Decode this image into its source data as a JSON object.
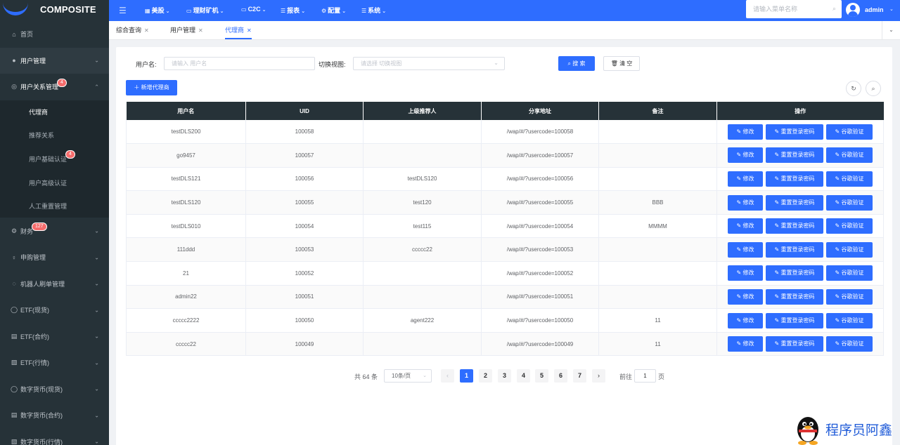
{
  "brand": {
    "title": "COMPOSITE"
  },
  "sidebar": {
    "items": [
      {
        "label": "首页",
        "icon": "home-icon"
      },
      {
        "label": "用户管理",
        "icon": "user-icon"
      },
      {
        "label": "用户关系管理",
        "icon": "user-circle-icon",
        "badge": "4"
      },
      {
        "label": "财务",
        "icon": "gear-icon",
        "badge": "127"
      },
      {
        "label": "申购管理",
        "icon": "bulb-icon"
      },
      {
        "label": "机器人刷单管理",
        "icon": "robot-icon"
      },
      {
        "label": "ETF(现货)",
        "icon": "coin-icon"
      },
      {
        "label": "ETF(合约)",
        "icon": "doc-icon"
      },
      {
        "label": "ETF(行情)",
        "icon": "edit-icon"
      },
      {
        "label": "数字货币(现货)",
        "icon": "coin-icon"
      },
      {
        "label": "数字货币(合约)",
        "icon": "doc-icon"
      },
      {
        "label": "数字货币(行情)",
        "icon": "edit-icon"
      }
    ],
    "sub_items": [
      {
        "label": "代理商"
      },
      {
        "label": "推荐关系"
      },
      {
        "label": "用户基础认证",
        "badge": "4"
      },
      {
        "label": "用户高级认证"
      },
      {
        "label": "人工重置管理"
      }
    ]
  },
  "topnav": {
    "items": [
      {
        "label": "美股"
      },
      {
        "label": "理财矿机"
      },
      {
        "label": "C2C"
      },
      {
        "label": "报表"
      },
      {
        "label": "配置"
      },
      {
        "label": "系统"
      }
    ],
    "search_placeholder": "请输入菜单名称",
    "username": "admin"
  },
  "tabs": [
    {
      "label": "综合查询"
    },
    {
      "label": "用户管理"
    },
    {
      "label": "代理商"
    }
  ],
  "filters": {
    "username_label": "用户名:",
    "username_placeholder": "请输入 用户名",
    "view_label": "切换视图:",
    "view_placeholder": "请选择 切换视图",
    "search_button": "搜 索",
    "clear_button": "清 空",
    "add_button": "新增代理商"
  },
  "table": {
    "columns": [
      "用户名",
      "UID",
      "上级推荐人",
      "分享地址",
      "备注",
      "操作"
    ],
    "actions": [
      "修改",
      "重置登录密码",
      "谷歌验证"
    ],
    "rows": [
      {
        "username": "testDLS200",
        "uid": "100058",
        "referrer": "",
        "share": "/wap/#/?usercode=100058",
        "remark": ""
      },
      {
        "username": "go9457",
        "uid": "100057",
        "referrer": "",
        "share": "/wap/#/?usercode=100057",
        "remark": ""
      },
      {
        "username": "testDLS121",
        "uid": "100056",
        "referrer": "testDLS120",
        "share": "/wap/#/?usercode=100056",
        "remark": ""
      },
      {
        "username": "testDLS120",
        "uid": "100055",
        "referrer": "test120",
        "share": "/wap/#/?usercode=100055",
        "remark": "BBB"
      },
      {
        "username": "testDLS010",
        "uid": "100054",
        "referrer": "test115",
        "share": "/wap/#/?usercode=100054",
        "remark": "MMMM"
      },
      {
        "username": "111ddd",
        "uid": "100053",
        "referrer": "ccccc22",
        "share": "/wap/#/?usercode=100053",
        "remark": ""
      },
      {
        "username": "21",
        "uid": "100052",
        "referrer": "",
        "share": "/wap/#/?usercode=100052",
        "remark": ""
      },
      {
        "username": "admin22",
        "uid": "100051",
        "referrer": "",
        "share": "/wap/#/?usercode=100051",
        "remark": ""
      },
      {
        "username": "ccccc2222",
        "uid": "100050",
        "referrer": "agent222",
        "share": "/wap/#/?usercode=100050",
        "remark": "11"
      },
      {
        "username": "ccccc22",
        "uid": "100049",
        "referrer": "",
        "share": "/wap/#/?usercode=100049",
        "remark": "11"
      }
    ]
  },
  "pagination": {
    "total": "共 64 条",
    "page_size": "10条/页",
    "pages": [
      "1",
      "2",
      "3",
      "4",
      "5",
      "6",
      "7"
    ],
    "current": "1",
    "goto_label": "前往",
    "goto_value": "1",
    "page_suffix": "页"
  },
  "watermark": {
    "text": "程序员阿鑫"
  },
  "colors": {
    "primary": "#2e6dff",
    "sidebar": "#263238",
    "header": "#263238",
    "badge": "#f56c6c"
  }
}
